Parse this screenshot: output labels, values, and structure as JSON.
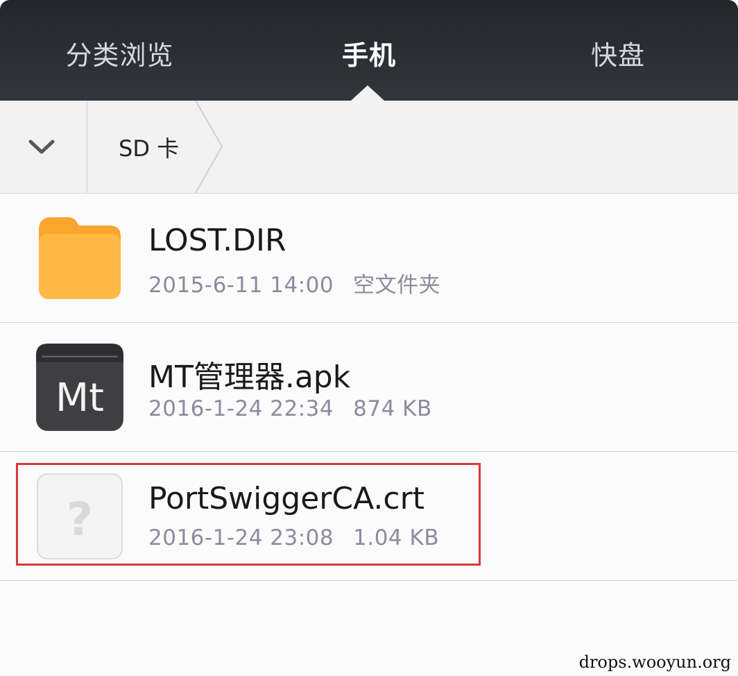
{
  "tabs": [
    {
      "label": "分类浏览",
      "active": false
    },
    {
      "label": "手机",
      "active": true
    },
    {
      "label": "快盘",
      "active": false
    }
  ],
  "breadcrumb": {
    "toggle_icon": "chevron-down-icon",
    "items": [
      "SD 卡"
    ]
  },
  "files": [
    {
      "name": "LOST.DIR",
      "date": "2015-6-11 14:00",
      "info": "空文件夹",
      "icon": "folder-icon"
    },
    {
      "name": "MT管理器.apk",
      "date": "2016-1-24 22:34",
      "info": "874 KB",
      "icon": "mt-app-icon",
      "icon_text": "Mt"
    },
    {
      "name": "PortSwiggerCA.crt",
      "date": "2016-1-24 23:08",
      "info": "1.04 KB",
      "icon": "unknown-file-icon",
      "icon_text": "?",
      "highlighted": true
    }
  ],
  "colors": {
    "tabbar_bg": "#2b2f35",
    "folder": "#fbb03b",
    "highlight_border": "#d63a3a",
    "meta_text": "#8e8a9d"
  },
  "watermark": "drops.wooyun.org"
}
